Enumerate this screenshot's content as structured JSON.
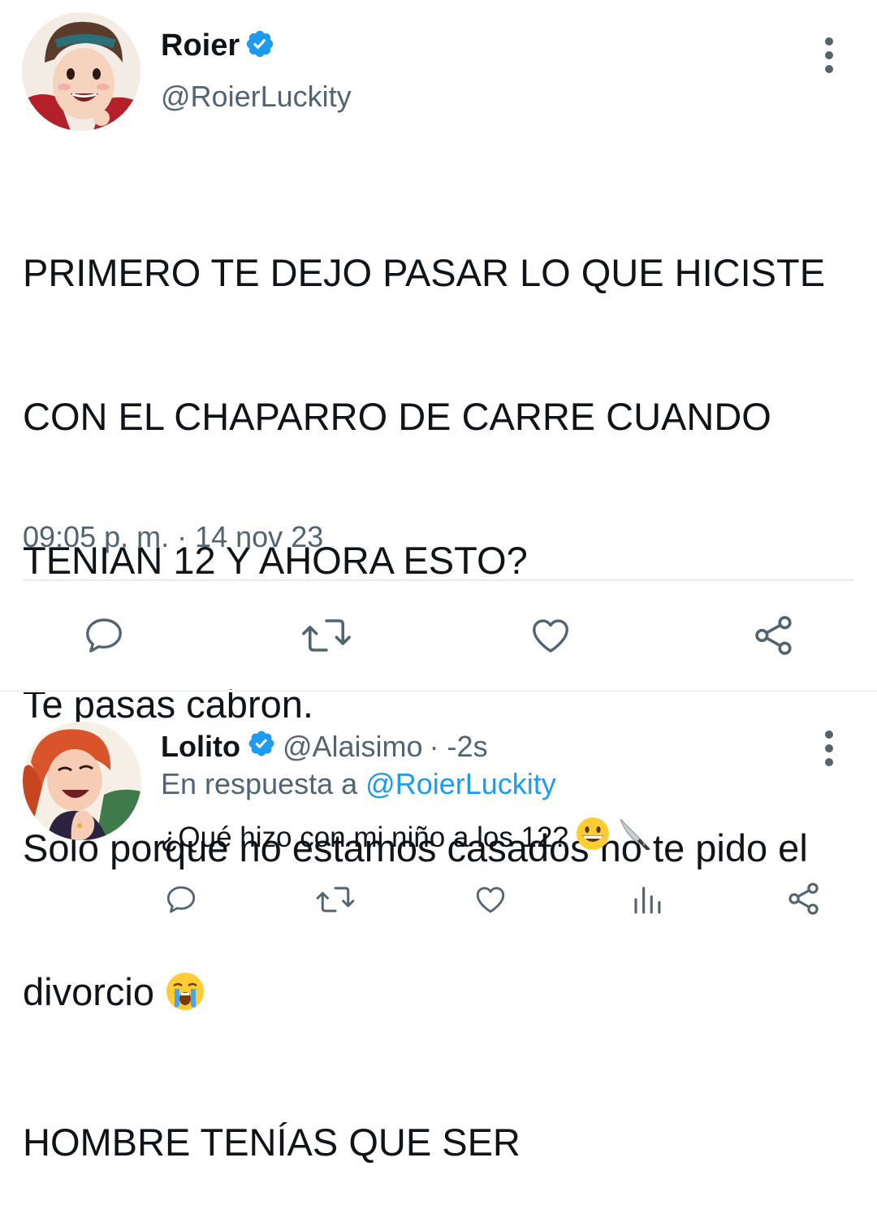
{
  "main_tweet": {
    "author_name": "Roier",
    "author_handle": "@RoierLuckity",
    "text_lines": [
      "PRIMERO TE DEJO PASAR LO QUE HICISTE",
      "CON EL CHAPARRO DE CARRE CUANDO",
      "TENIAN 12 Y AHORA ESTO?",
      "Te pasas cabron.",
      "Solo porque no estamos casados no te pido el",
      "divorcio",
      "HOMBRE TENÍAS QUE SER"
    ],
    "emoji": "loudly-crying-face",
    "timestamp": "09:05 p. m. · 14 nov 23"
  },
  "reply": {
    "author_name": "Lolito",
    "author_handle": "@Alaisimo",
    "time": "· -2s",
    "context_prefix": "En respuesta a",
    "context_mention": "@RoierLuckity",
    "text": "¿Qué hizo con mi niño a los 12?",
    "emojis": [
      "grinning-face",
      "kitchen-knife"
    ]
  },
  "icons": {
    "verified": "verified-badge-icon",
    "more": "more-vertical-icon",
    "reply": "reply-icon",
    "retweet": "retweet-icon",
    "like": "like-icon",
    "share": "share-icon",
    "analytics": "analytics-icon"
  },
  "colors": {
    "text": "#0f1419",
    "secondary": "#536471",
    "accent": "#1d9bf0",
    "divider": "#e7e9ea"
  }
}
